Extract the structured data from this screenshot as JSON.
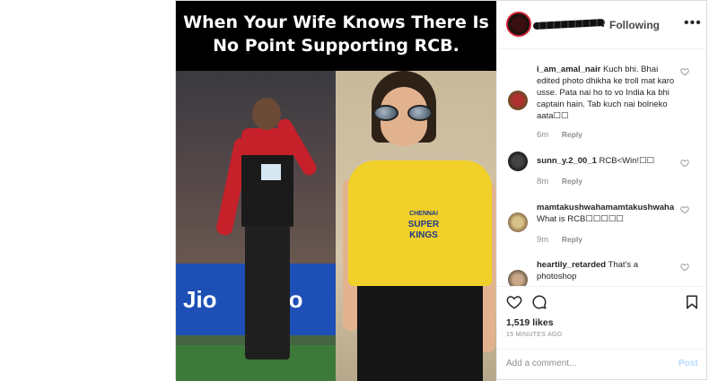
{
  "post": {
    "caption_image_text_line1": "When Your Wife Knows There Is",
    "caption_image_text_line2": "No Point Supporting RCB.",
    "left_photo_banner": "Jio",
    "right_photo_logo_line1": "CHENNAI",
    "right_photo_logo_line2": "SUPER",
    "right_photo_logo_line3": "KINGS"
  },
  "header": {
    "following_label": "Following",
    "more_icon": "more-horizontal-icon"
  },
  "comments": [
    {
      "username": "i_am_amal_nair",
      "text": "Kuch bhi. Bhai edited photo dhikha ke troll mat karo usse. Pata nai ho to vo India ka bhi captain hain. Tab kuch nai bolneko aata☐☐",
      "time": "6m",
      "reply": "Reply"
    },
    {
      "username": "sunn_y.2_00_1",
      "text": "RCB<Win!☐☐",
      "time": "8m",
      "reply": "Reply"
    },
    {
      "username": "mamtakushwahamamtakushwaha",
      "text": "What is RCB☐☐☐☐☐",
      "time": "9m",
      "reply": "Reply"
    },
    {
      "username": "heartily_retarded",
      "text": "That's a photoshop",
      "time": "",
      "reply": ""
    }
  ],
  "actions": {
    "likes": "1,519 likes",
    "timestamp": "15 MINUTES AGO"
  },
  "add_comment": {
    "placeholder": "Add a comment...",
    "post_label": "Post"
  },
  "colors": {
    "border": "#dbdbdb",
    "muted": "#8e8e8e",
    "post_button_disabled": "#b3dbff"
  }
}
